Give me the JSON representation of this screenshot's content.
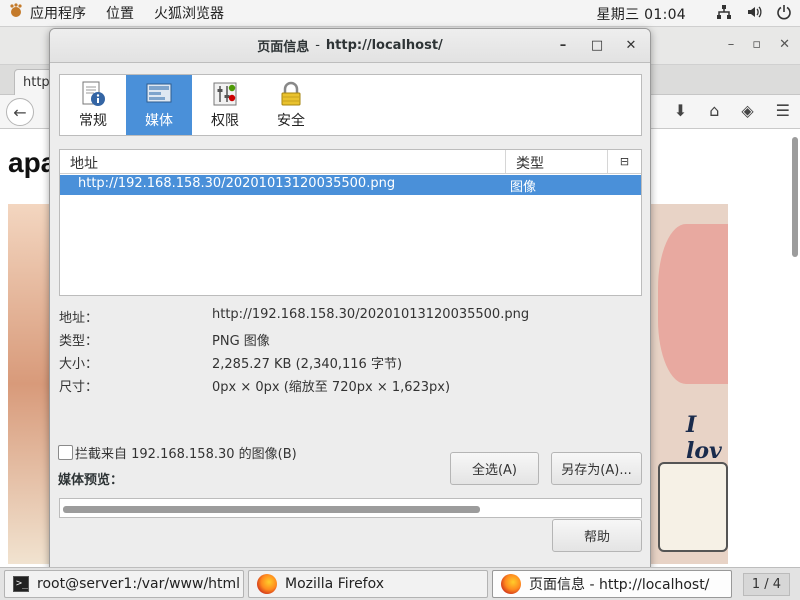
{
  "top_panel": {
    "apps_label": "应用程序",
    "places_label": "位置",
    "active_app_label": "火狐浏览器",
    "clock": "星期三 01:04"
  },
  "browser": {
    "tab_label": "http",
    "page_heading": "apa",
    "image_overlay_text": "I lov"
  },
  "dialog": {
    "title": "页面信息",
    "title_sep": "-",
    "title_url": "http://localhost/",
    "toolbar": [
      {
        "label": "常规",
        "icon": "info-icon"
      },
      {
        "label": "媒体",
        "icon": "media-icon"
      },
      {
        "label": "权限",
        "icon": "permissions-icon"
      },
      {
        "label": "安全",
        "icon": "lock-icon"
      }
    ],
    "media_list": {
      "headers": {
        "address": "地址",
        "type": "类型"
      },
      "rows": [
        {
          "address": "http://192.168.158.30/20201013120035500.png",
          "type": "图像"
        }
      ]
    },
    "props": {
      "address_label": "地址：",
      "address_value": "http://192.168.158.30/20201013120035500.png",
      "type_label": "类型：",
      "type_value": "PNG 图像",
      "size_label": "大小：",
      "size_value": "2,285.27 KB (2,340,116 字节)",
      "dims_label": "尺寸：",
      "dims_value": "0px × 0px (缩放至 720px × 1,623px)"
    },
    "block_label": "拦截来自 192.168.158.30 的图像(B)",
    "preview_label": "媒体预览：",
    "select_all_label": "全选(A)",
    "save_as_label": "另存为(A)...",
    "help_label": "帮助"
  },
  "taskbar": {
    "items": [
      {
        "label": "root@server1:/var/www/html"
      },
      {
        "label": "Mozilla Firefox"
      },
      {
        "label": "页面信息 - http://localhost/"
      }
    ],
    "pager": "1 / 4"
  },
  "colors": {
    "selection": "#4a90d9",
    "panel_bg": "#f4f4f4",
    "dialog_bg": "#ededed"
  }
}
